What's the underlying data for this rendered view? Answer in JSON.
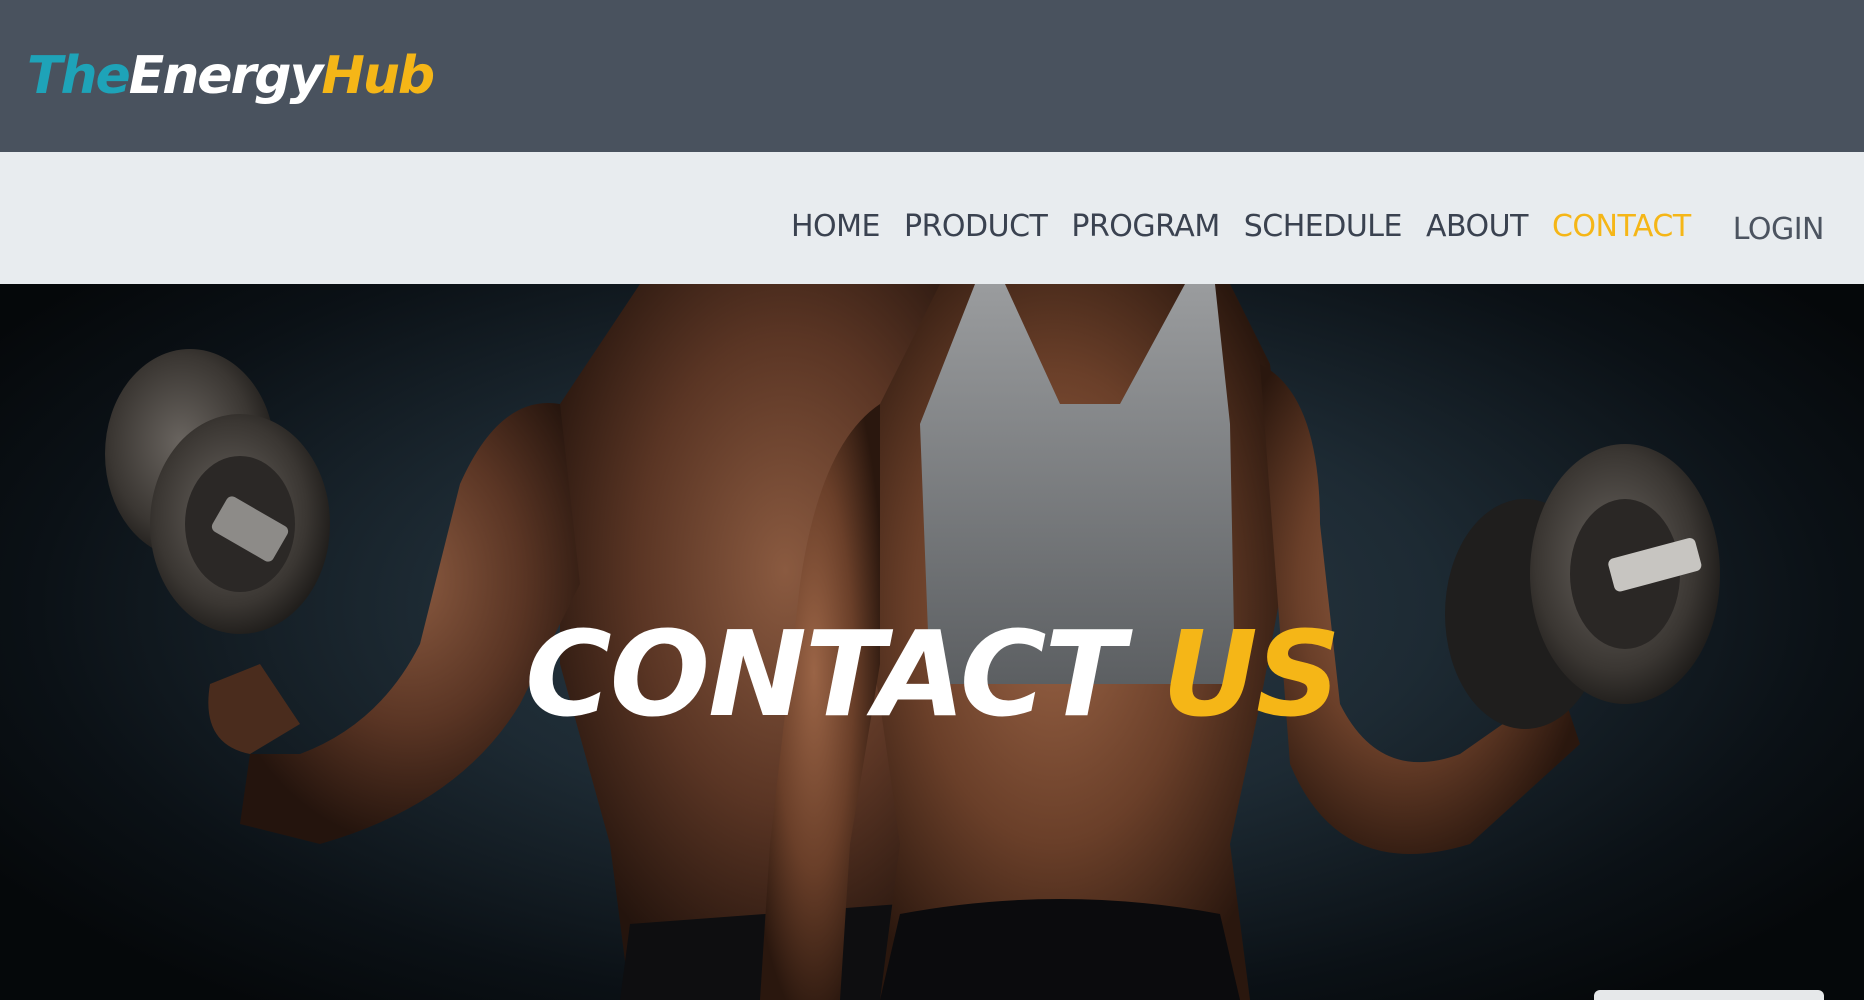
{
  "logo": {
    "part1": "The",
    "part2": "Energy",
    "part3": "Hub"
  },
  "nav": {
    "items": [
      {
        "label": "HOME"
      },
      {
        "label": "PRODUCT"
      },
      {
        "label": "PROGRAM"
      },
      {
        "label": "SCHEDULE"
      },
      {
        "label": "ABOUT"
      },
      {
        "label": "CONTACT"
      }
    ],
    "active": "CONTACT",
    "login_label": "LOGIN"
  },
  "hero": {
    "title_part1": "CONTACT",
    "title_part2": "US"
  },
  "colors": {
    "header_bg": "#49525e",
    "nav_bg": "#e8ecef",
    "accent": "#f5b617",
    "logo_teal": "#1ea3b8"
  }
}
